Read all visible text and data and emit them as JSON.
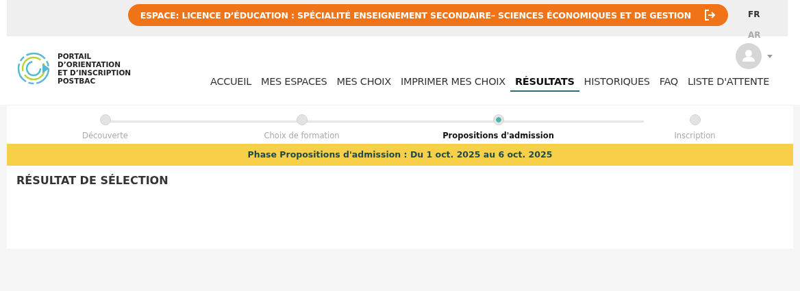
{
  "banner": {
    "text": "ESPACE: LICENCE D’ÉDUCATION : SPÉCIALITÉ ENSEIGNEMENT SECONDAIRE– SCIENCES ÉCONOMIQUES ET DE GESTION"
  },
  "languages": [
    {
      "label": "FR",
      "selected": true
    },
    {
      "label": "AR",
      "selected": false
    }
  ],
  "logo": {
    "lines": [
      "PORTAIL",
      "D’ORIENTATION",
      "ET D’INSCRIPTION",
      "POSTBAC"
    ]
  },
  "nav": [
    {
      "label": "ACCUEIL",
      "selected": false
    },
    {
      "label": "MES ESPACES",
      "selected": false
    },
    {
      "label": "MES CHOIX",
      "selected": false
    },
    {
      "label": "IMPRIMER MES CHOIX",
      "selected": false
    },
    {
      "label": "RÉSULTATS",
      "selected": true
    },
    {
      "label": "HISTORIQUES",
      "selected": false
    },
    {
      "label": "FAQ",
      "selected": false
    },
    {
      "label": "LISTE D'ATTENTE",
      "selected": false
    }
  ],
  "steps": [
    {
      "label": "Découverte",
      "selected": false
    },
    {
      "label": "Choix de formation",
      "selected": false
    },
    {
      "label": "Propositions d'admission",
      "selected": true
    },
    {
      "label": "Inscription",
      "selected": false
    }
  ],
  "phase_notice": "Phase Propositions d'admission : Du 1 oct. 2025 au 6 oct. 2025",
  "section_title": "RÉSULTAT DE SÉLECTION"
}
